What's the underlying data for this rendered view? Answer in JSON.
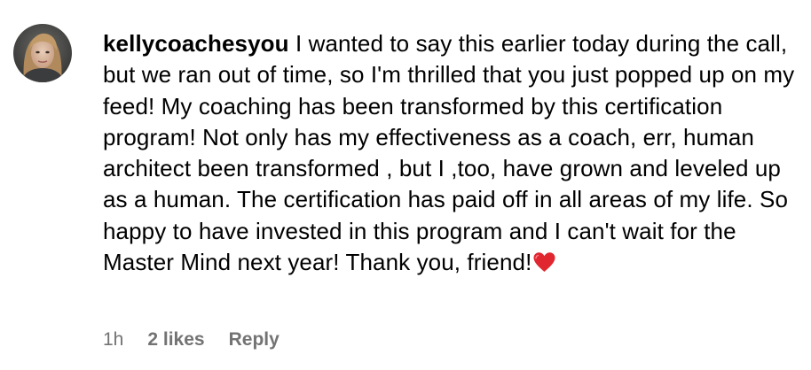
{
  "comment": {
    "username": "kellycoachesyou",
    "text": "I wanted to say this earlier today during the call, but we ran out of time, so I'm thrilled that you just popped up on my feed! My coaching has been transformed by this certification program! Not only has my effectiveness as a coach, err, human architect been transformed , but I ,too, have grown and leveled up as a human. The certification has paid off in all areas of my life. So happy to have invested in this program and I can't wait for the Master Mind next year! Thank you, friend!",
    "emoji": "heart-icon",
    "time": "1h",
    "likes": "2 likes",
    "reply_label": "Reply"
  },
  "colors": {
    "text": "#000000",
    "meta": "#737373",
    "heart": "#e0262f"
  }
}
